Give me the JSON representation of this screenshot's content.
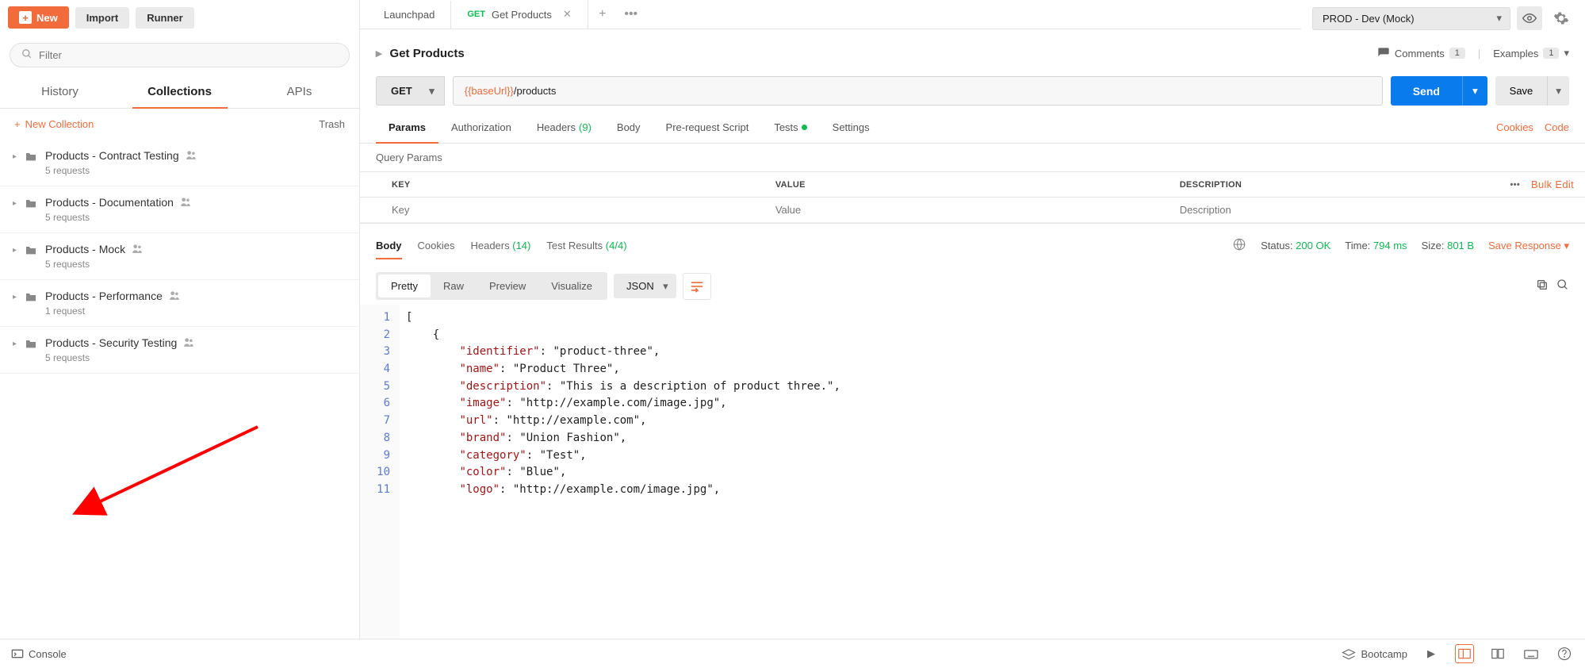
{
  "toolbar": {
    "new_label": "New",
    "import_label": "Import",
    "runner_label": "Runner"
  },
  "environment": {
    "selected": "PROD - Dev (Mock)"
  },
  "sidebar": {
    "filter_placeholder": "Filter",
    "tabs": {
      "history": "History",
      "collections": "Collections",
      "apis": "APIs"
    },
    "new_collection_label": "New Collection",
    "trash_label": "Trash",
    "collections": [
      {
        "name": "Products - Contract Testing",
        "count": "5 requests"
      },
      {
        "name": "Products - Documentation",
        "count": "5 requests"
      },
      {
        "name": "Products - Mock",
        "count": "5 requests"
      },
      {
        "name": "Products - Performance",
        "count": "1 request"
      },
      {
        "name": "Products - Security Testing",
        "count": "5 requests"
      }
    ]
  },
  "tabs": {
    "items": [
      {
        "label": "Launchpad",
        "method": ""
      },
      {
        "label": "Get Products",
        "method": "GET"
      }
    ]
  },
  "request": {
    "title": "Get Products",
    "comments_label": "Comments",
    "comments_count": "1",
    "examples_label": "Examples",
    "examples_count": "1",
    "method": "GET",
    "url_var": "{{baseUrl}}",
    "url_path": "/products",
    "send_label": "Send",
    "save_label": "Save",
    "subtabs": {
      "params": "Params",
      "authorization": "Authorization",
      "headers": "Headers",
      "headers_count": "(9)",
      "body": "Body",
      "prerequest": "Pre-request Script",
      "tests": "Tests",
      "settings": "Settings"
    },
    "cookies_link": "Cookies",
    "code_link": "Code",
    "query_params_label": "Query Params",
    "params_headers": {
      "key": "KEY",
      "value": "VALUE",
      "description": "DESCRIPTION"
    },
    "params_placeholders": {
      "key": "Key",
      "value": "Value",
      "description": "Description"
    },
    "bulk_edit_label": "Bulk Edit"
  },
  "response": {
    "tabs": {
      "body": "Body",
      "cookies": "Cookies",
      "headers": "Headers",
      "headers_count": "(14)",
      "tests": "Test Results",
      "tests_count": "(4/4)"
    },
    "status_label": "Status:",
    "status_value": "200 OK",
    "time_label": "Time:",
    "time_value": "794 ms",
    "size_label": "Size:",
    "size_value": "801 B",
    "save_response_label": "Save Response",
    "view": {
      "pretty": "Pretty",
      "raw": "Raw",
      "preview": "Preview",
      "visualize": "Visualize"
    },
    "format": "JSON",
    "code_lines": [
      "[",
      "    {",
      "        \"identifier\": \"product-three\",",
      "        \"name\": \"Product Three\",",
      "        \"description\": \"This is a description of product three.\",",
      "        \"image\": \"http://example.com/image.jpg\",",
      "        \"url\": \"http://example.com\",",
      "        \"brand\": \"Union Fashion\",",
      "        \"category\": \"Test\",",
      "        \"color\": \"Blue\",",
      "        \"logo\": \"http://example.com/image.jpg\","
    ]
  },
  "bottombar": {
    "console": "Console",
    "bootcamp": "Bootcamp"
  }
}
